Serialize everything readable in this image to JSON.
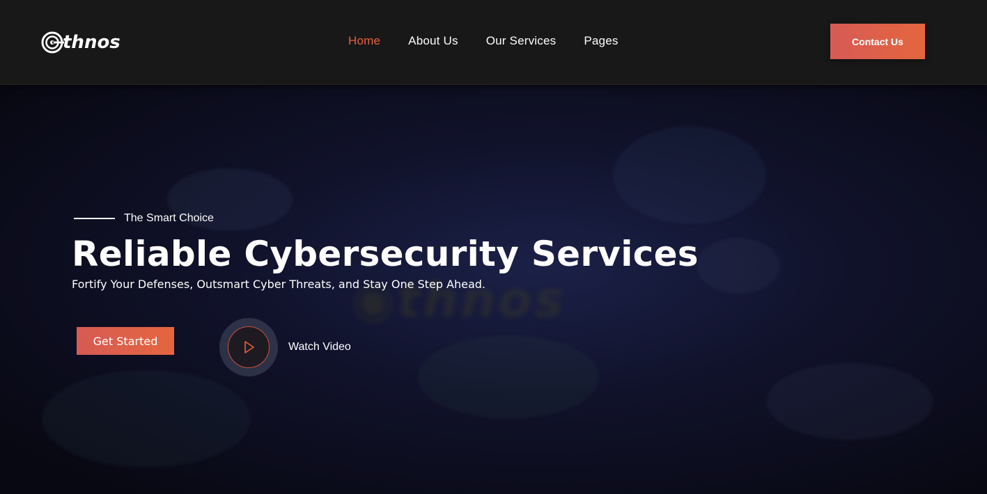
{
  "brand": {
    "name": "thnos",
    "logo_icon": "ethnos-logo-icon"
  },
  "nav": {
    "items": [
      {
        "label": "Home",
        "active": true
      },
      {
        "label": "About Us",
        "active": false
      },
      {
        "label": "Our Services",
        "active": false
      },
      {
        "label": "Pages",
        "active": false
      }
    ],
    "active_color": "#e8603c"
  },
  "header": {
    "contact_label": "Contact Us"
  },
  "hero": {
    "eyebrow": "The Smart Choice",
    "title": "Reliable Cybersecurity Services",
    "subtitle": "Fortify Your Defenses, Outsmart Cyber Threats, and Stay One Step Ahead.",
    "primary_button": "Get Started",
    "video_label": "Watch Video",
    "play_icon": "play-icon"
  },
  "colors": {
    "accent_start": "#d75a55",
    "accent_end": "#e4663e",
    "header_bg": "#181818",
    "hero_bg": "#0b0d1a"
  }
}
